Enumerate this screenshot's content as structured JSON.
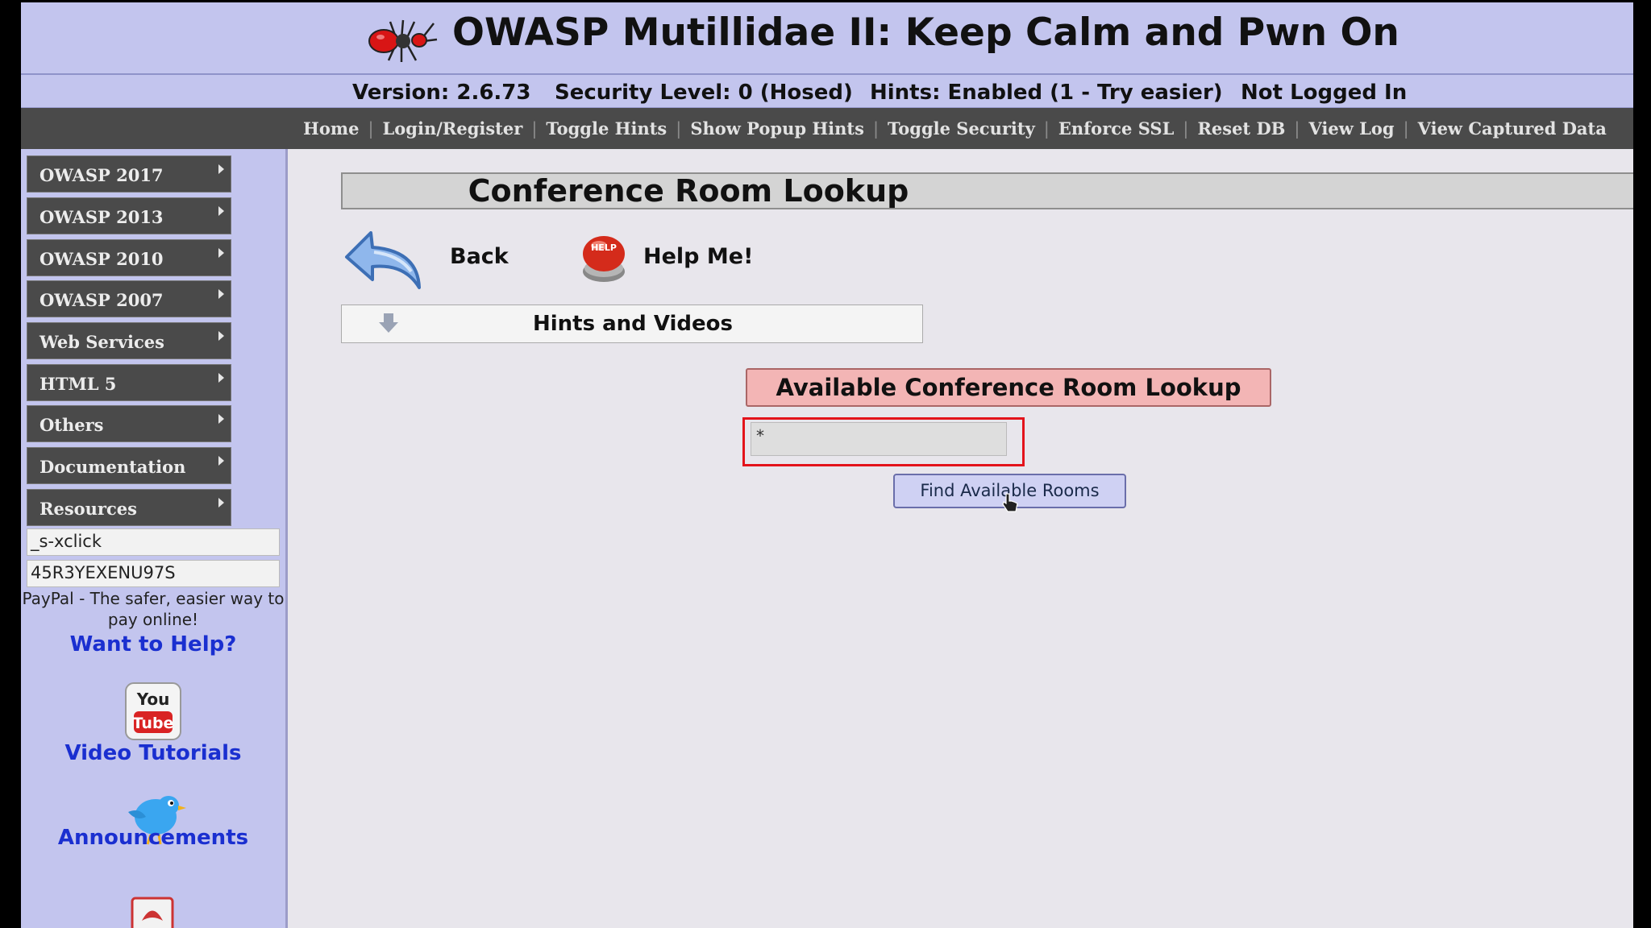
{
  "header": {
    "title": "OWASP Mutillidae II: Keep Calm and Pwn On",
    "version": "Version: 2.6.73",
    "security_level": "Security Level: 0 (Hosed)",
    "hints": "Hints: Enabled (1 - Try easier)",
    "login_status": "Not Logged In"
  },
  "nav": {
    "links": [
      "Home",
      "Login/Register",
      "Toggle Hints",
      "Show Popup Hints",
      "Toggle Security",
      "Enforce SSL",
      "Reset DB",
      "View Log",
      "View Captured Data"
    ]
  },
  "sidebar": {
    "menu": [
      "OWASP 2017",
      "OWASP 2013",
      "OWASP 2010",
      "OWASP 2007",
      "Web Services",
      "HTML 5",
      "Others",
      "Documentation",
      "Resources"
    ],
    "input1_value": "_s-xclick",
    "input2_value": "45R3YEXENU97S",
    "paypal_text": "PayPal - The safer, easier way to pay online!",
    "want_to_help": "Want to Help?",
    "youtube_top": "You",
    "youtube_bottom": "Tube",
    "video_tutorials": "Video Tutorials",
    "announcements": "Announcements"
  },
  "content": {
    "page_title": "Conference Room Lookup",
    "back_label": "Back",
    "help_badge": "HELP",
    "help_label": "Help Me!",
    "hints_label": "Hints and Videos",
    "lookup_header": "Available Conference Room Lookup",
    "room_input_value": "*",
    "find_button": "Find Available Rooms"
  },
  "colors": {
    "header_bg": "#c3c5ee",
    "nav_bg": "#4a4a4a",
    "link_blue": "#1a2fd0",
    "lookup_header_bg": "#f3b5b5",
    "highlight_outline": "#e3131b"
  }
}
